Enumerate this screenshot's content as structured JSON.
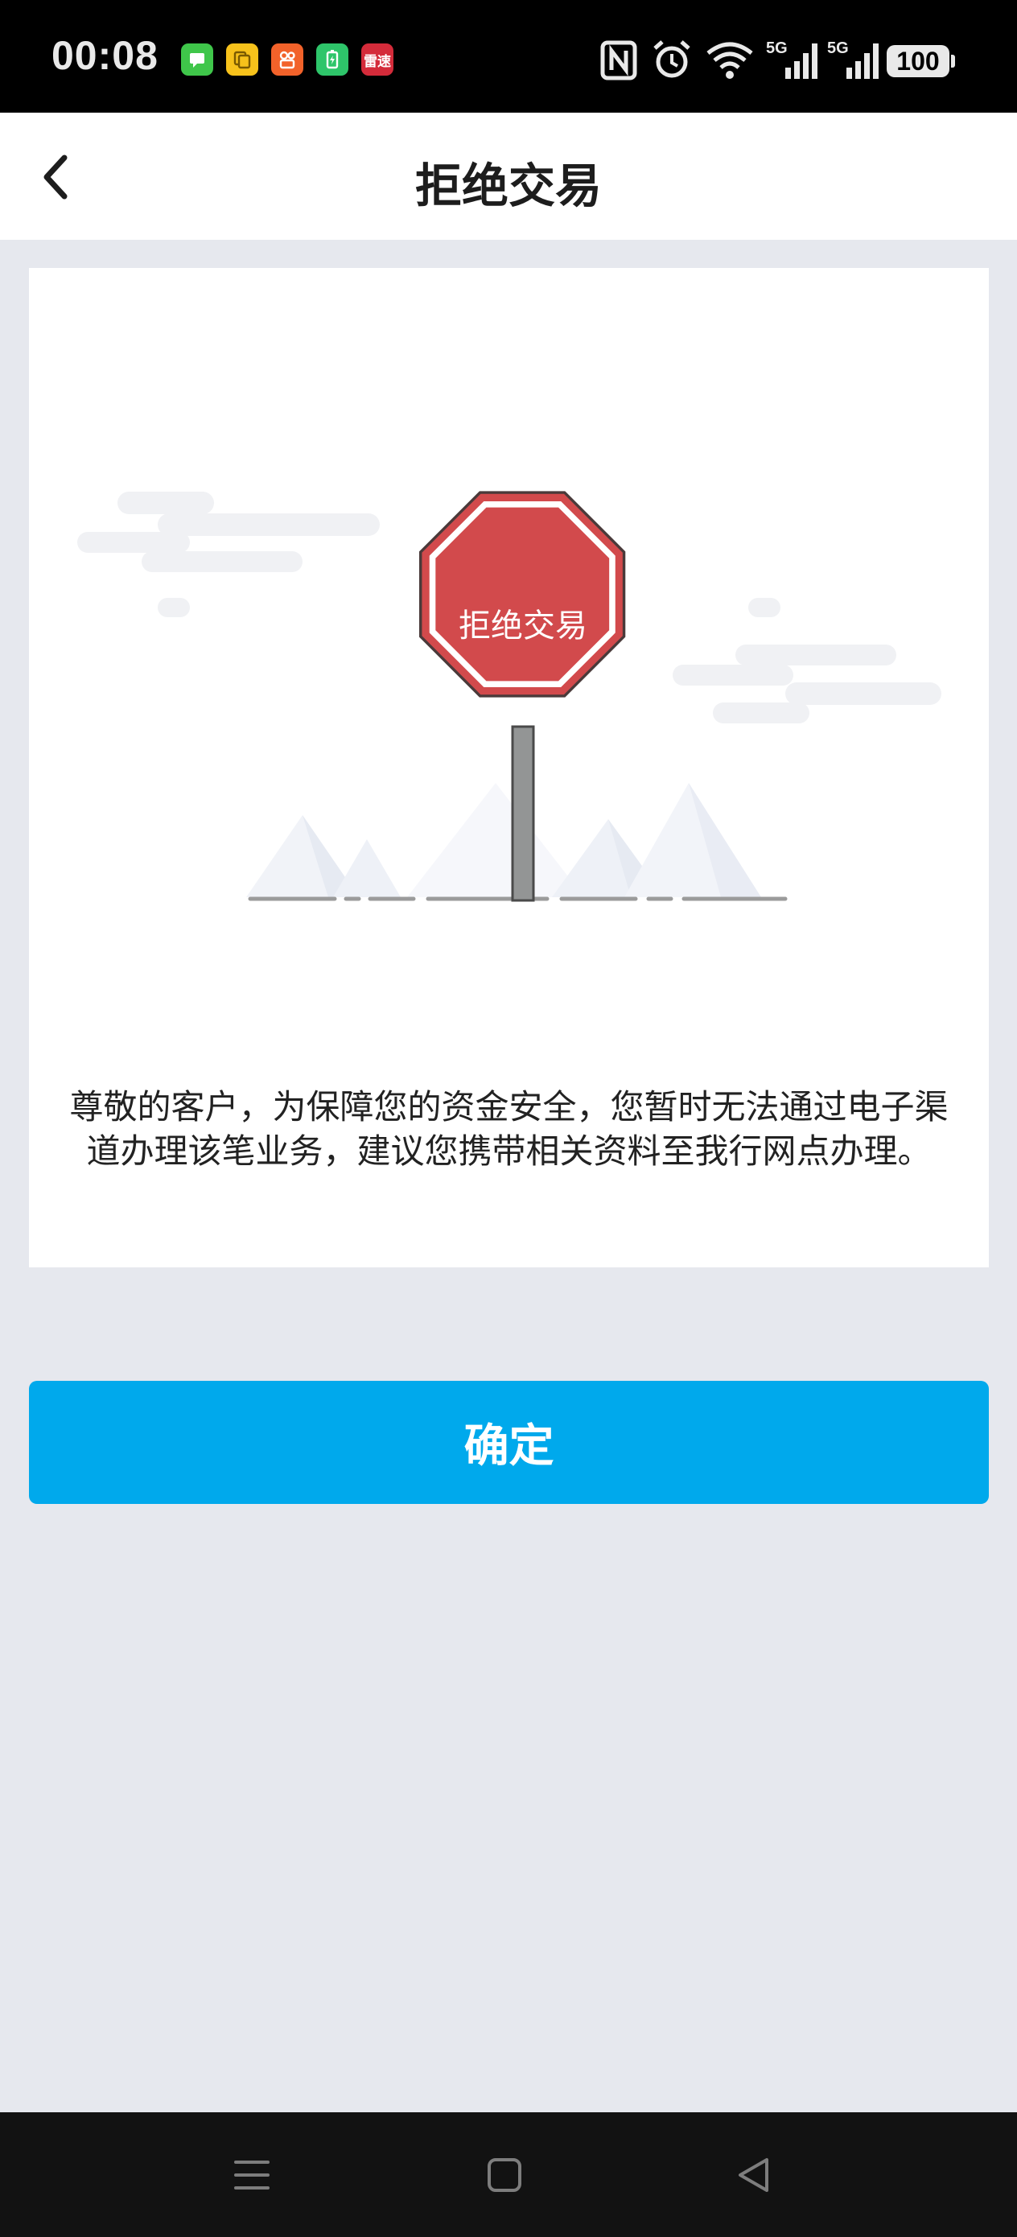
{
  "status_bar": {
    "time": "00:08",
    "app_icons": [
      "messages-icon",
      "files-icon",
      "kuaishou-icon",
      "battery-manager-icon",
      "leisu-icon"
    ],
    "leisu_label": "雷速",
    "system_icons": [
      "nfc-icon",
      "alarm-icon",
      "wifi-icon",
      "signal-5g-icon",
      "signal-5g-icon"
    ],
    "network_label_1": "5G",
    "network_label_2": "5G",
    "battery": "100"
  },
  "header": {
    "title": "拒绝交易",
    "back_icon": "chevron-left-icon"
  },
  "card": {
    "sign_text": "拒绝交易",
    "message": "尊敬的客户，为保障您的资金安全，您暂时无法通过电子渠道办理该笔业务，建议您携带相关资料至我行网点办理。"
  },
  "confirm_label": "确定",
  "nav_bar": {
    "icons": [
      "menu-icon",
      "home-icon",
      "back-icon"
    ]
  },
  "colors": {
    "primary": "#00a9ec",
    "sign_red": "#d24a4c",
    "background": "#e6e8ee"
  }
}
